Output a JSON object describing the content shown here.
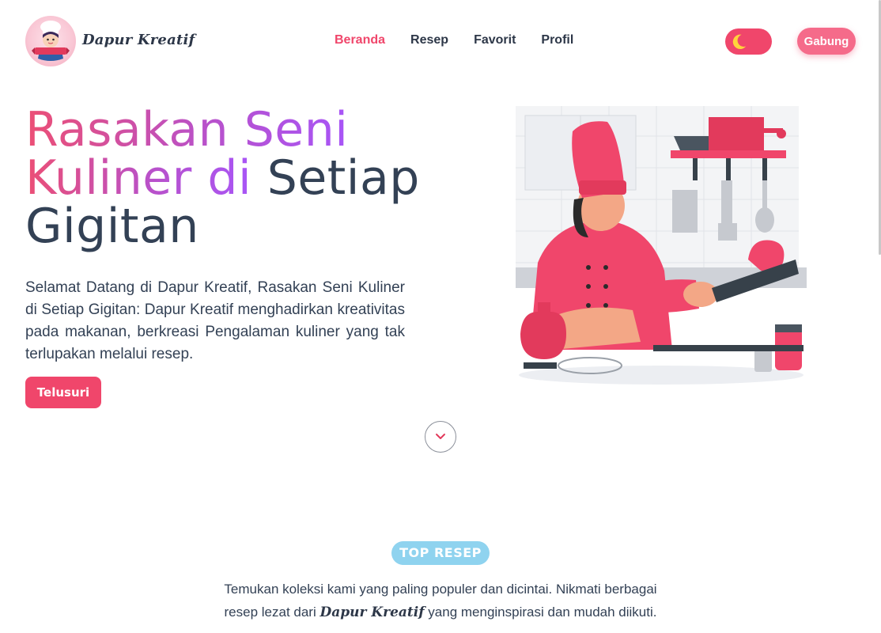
{
  "header": {
    "brand": "Dapur Kreatif",
    "nav": [
      {
        "label": "Beranda",
        "active": true
      },
      {
        "label": "Resep",
        "active": false
      },
      {
        "label": "Favorit",
        "active": false
      },
      {
        "label": "Profil",
        "active": false
      }
    ],
    "theme_toggle_icon": "moon-icon",
    "join_label": "Gabung"
  },
  "hero": {
    "title_part1": "Rasakan Seni",
    "title_part2": "Kuliner di",
    "title_part3": "Setiap",
    "title_part4": "Gigitan",
    "description": "Selamat Datang di Dapur Kreatif, Rasakan Seni Kuliner di Setiap Gigitan: Dapur Kreatif menghadirkan kreativitas pada makanan, berkreasi Pengalaman kuliner yang tak terlupakan melalui resep.",
    "cta_label": "Telusuri",
    "scroll_icon": "chevron-down-icon"
  },
  "top_recipes": {
    "badge": "TOP RESEP",
    "desc_before": "Temukan koleksi kami yang paling populer dan dicintai. Nikmati berbagai resep lezat dari",
    "desc_brand": "Dapur Kreatif",
    "desc_after": "yang menginspirasi dan mudah diikuti."
  },
  "colors": {
    "accent": "#f0466b",
    "gradient_start": "#ec4f75",
    "gradient_end": "#a855f7",
    "badge": "#8fd3ef",
    "text": "#334155"
  }
}
